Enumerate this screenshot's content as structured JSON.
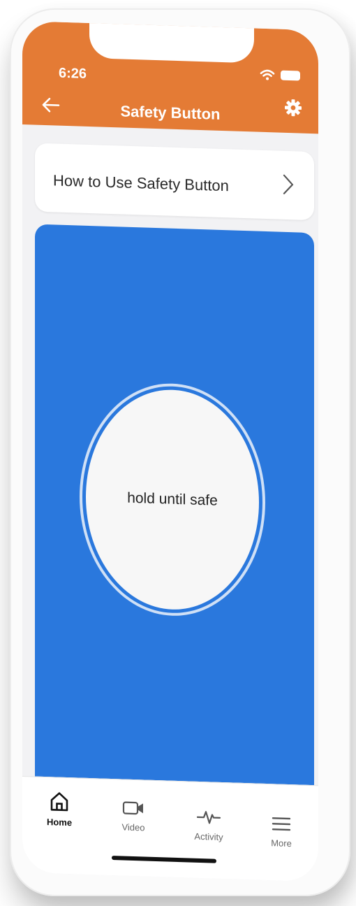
{
  "status_bar": {
    "time": "6:26",
    "icons": [
      "wifi-icon",
      "battery-icon"
    ]
  },
  "header": {
    "title": "Safety Button",
    "back_icon": "back-arrow-icon",
    "settings_icon": "gear-icon",
    "background_color": "#e47b35"
  },
  "howto": {
    "label": "How to Use Safety Button",
    "icon": "chevron-right-icon"
  },
  "safety_panel": {
    "background_color": "#2a78dd",
    "button_label": "hold until safe"
  },
  "tabs": [
    {
      "label": "Home",
      "icon": "home-icon",
      "active": true
    },
    {
      "label": "Video",
      "icon": "video-camera-icon",
      "active": false
    },
    {
      "label": "Activity",
      "icon": "activity-pulse-icon",
      "active": false
    },
    {
      "label": "More",
      "icon": "menu-lines-icon",
      "active": false
    }
  ]
}
